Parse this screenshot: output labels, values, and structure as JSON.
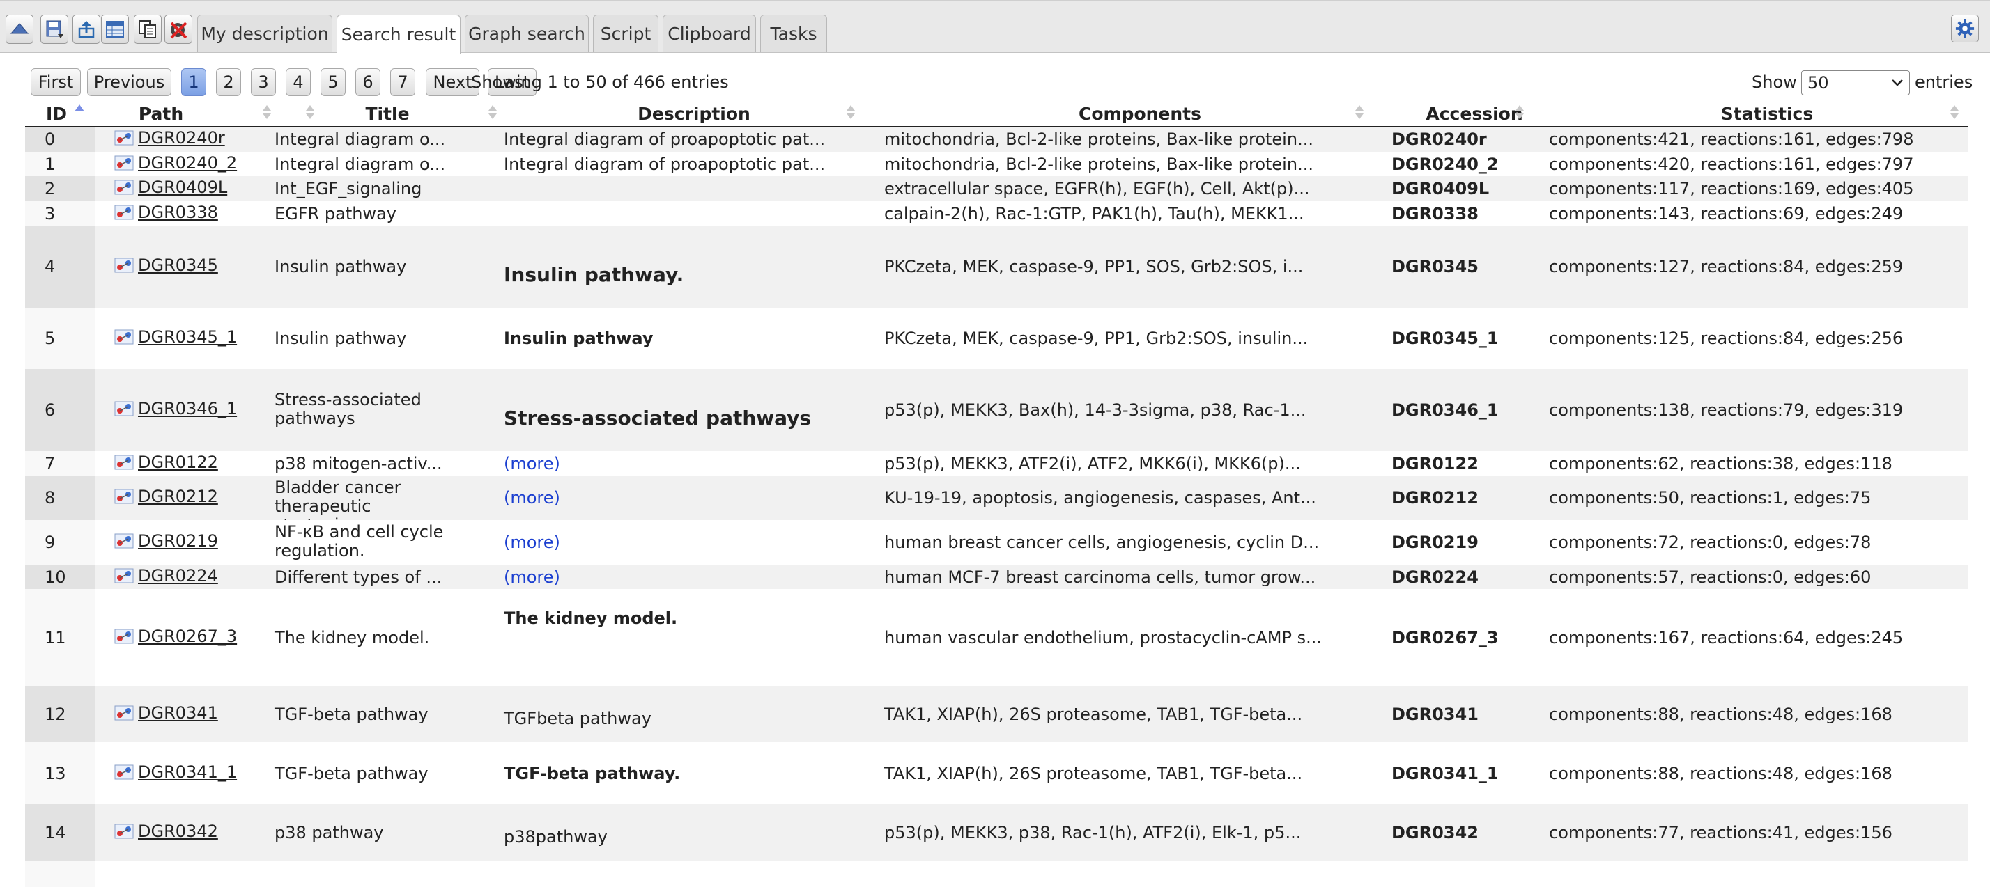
{
  "toolbar": {
    "icons": [
      "collapse-up-icon",
      "save-icon",
      "export-icon",
      "table-icon",
      "copy-icon",
      "tools-icon"
    ],
    "tabs": [
      "My description",
      "Search result",
      "Graph search",
      "Script",
      "Clipboard",
      "Tasks"
    ],
    "active_tab": "Search result",
    "settings_icon": "gear-icon"
  },
  "pagination": {
    "first": "First",
    "previous": "Previous",
    "pages": [
      "1",
      "2",
      "3",
      "4",
      "5",
      "6",
      "7"
    ],
    "current": "1",
    "next": "Next",
    "last": "Last",
    "info": "Showing 1 to 50 of 466 entries"
  },
  "length_menu": {
    "show": "Show",
    "value": "50",
    "entries": "entries"
  },
  "columns": [
    "ID",
    "Path",
    "Title",
    "Description",
    "Components",
    "Accession",
    "Statistics"
  ],
  "sorted_column": "ID",
  "rows": [
    {
      "id": "0",
      "path": "DGR0240r",
      "title": "Integral diagram o...",
      "description": "Integral diagram of proapoptotic pat...",
      "components": "mitochondria, Bcl-2-like proteins, Bax-like protein...",
      "accession": "DGR0240r",
      "statistics": "components:421, reactions:161, edges:798"
    },
    {
      "id": "1",
      "path": "DGR0240_2",
      "title": "Integral diagram o...",
      "description": "Integral diagram of proapoptotic pat...",
      "components": "mitochondria, Bcl-2-like proteins, Bax-like protein...",
      "accession": "DGR0240_2",
      "statistics": "components:420, reactions:161, edges:797"
    },
    {
      "id": "2",
      "path": "DGR0409L",
      "title": "Int_EGF_signaling",
      "description": "",
      "components": "extracellular space, EGFR(h), EGF(h), Cell, Akt(p)...",
      "accession": "DGR0409L",
      "statistics": "components:117, reactions:169, edges:405"
    },
    {
      "id": "3",
      "path": "DGR0338",
      "title": "EGFR pathway",
      "description": "",
      "components": "calpain-2(h), Rac-1:GTP, PAK1(h), Tau(h), MEKK1...",
      "accession": "DGR0338",
      "statistics": "components:143, reactions:69, edges:249"
    },
    {
      "id": "4",
      "path": "DGR0345",
      "title": "Insulin pathway",
      "description": "Insulin pathway.",
      "components": "PKCzeta, MEK, caspase-9, PP1, SOS, Grb2:SOS, i...",
      "accession": "DGR0345",
      "statistics": "components:127, reactions:84, edges:259"
    },
    {
      "id": "5",
      "path": "DGR0345_1",
      "title": "Insulin pathway",
      "description": "Insulin pathway",
      "components": "PKCzeta, MEK, caspase-9, PP1, Grb2:SOS, insulin...",
      "accession": "DGR0345_1",
      "statistics": "components:125, reactions:84, edges:256"
    },
    {
      "id": "6",
      "path": "DGR0346_1",
      "title": "Stress-associated pathways",
      "description": "Stress-associated pathways",
      "components": "p53(p), MEKK3, Bax(h), 14-3-3sigma, p38, Rac-1...",
      "accession": "DGR0346_1",
      "statistics": "components:138, reactions:79, edges:319"
    },
    {
      "id": "7",
      "path": "DGR0122",
      "title": "p38 mitogen-activ...",
      "description": "(more)",
      "components": "p53(p), MEKK3, ATF2(i), ATF2, MKK6(i), MKK6(p)...",
      "accession": "DGR0122",
      "statistics": "components:62, reactions:38, edges:118"
    },
    {
      "id": "8",
      "path": "DGR0212",
      "title": "Bladder cancer therapeutic strategies.",
      "description": "(more)",
      "components": "KU-19-19, apoptosis, angiogenesis, caspases, Ant...",
      "accession": "DGR0212",
      "statistics": "components:50, reactions:1, edges:75"
    },
    {
      "id": "9",
      "path": "DGR0219",
      "title": "NF-κB and cell cycle regulation.",
      "description": "(more)",
      "components": "human breast cancer cells, angiogenesis, cyclin D...",
      "accession": "DGR0219",
      "statistics": "components:72, reactions:0, edges:78"
    },
    {
      "id": "10",
      "path": "DGR0224",
      "title": "Different types of ...",
      "description": "(more)",
      "components": "human MCF-7 breast carcinoma cells, tumor grow...",
      "accession": "DGR0224",
      "statistics": "components:57, reactions:0, edges:60"
    },
    {
      "id": "11",
      "path": "DGR0267_3",
      "title": "The kidney model.",
      "description": "The kidney model.",
      "components": "human vascular endothelium, prostacyclin-cAMP s...",
      "accession": "DGR0267_3",
      "statistics": "components:167, reactions:64, edges:245"
    },
    {
      "id": "12",
      "path": "DGR0341",
      "title": "TGF-beta pathway",
      "description": "TGFbeta pathway",
      "components": "TAK1, XIAP(h), 26S proteasome, TAB1, TGF-beta...",
      "accession": "DGR0341",
      "statistics": "components:88, reactions:48, edges:168"
    },
    {
      "id": "13",
      "path": "DGR0341_1",
      "title": "TGF-beta pathway",
      "description": "TGF-beta pathway.",
      "components": "TAK1, XIAP(h), 26S proteasome, TAB1, TGF-beta...",
      "accession": "DGR0341_1",
      "statistics": "components:88, reactions:48, edges:168"
    },
    {
      "id": "14",
      "path": "DGR0342",
      "title": "p38 pathway",
      "description": "p38pathway",
      "components": "p53(p), MEKK3, p38, Rac-1(h), ATF2(i), Elk-1, p5...",
      "accession": "DGR0342",
      "statistics": "components:77, reactions:41, edges:156"
    }
  ]
}
